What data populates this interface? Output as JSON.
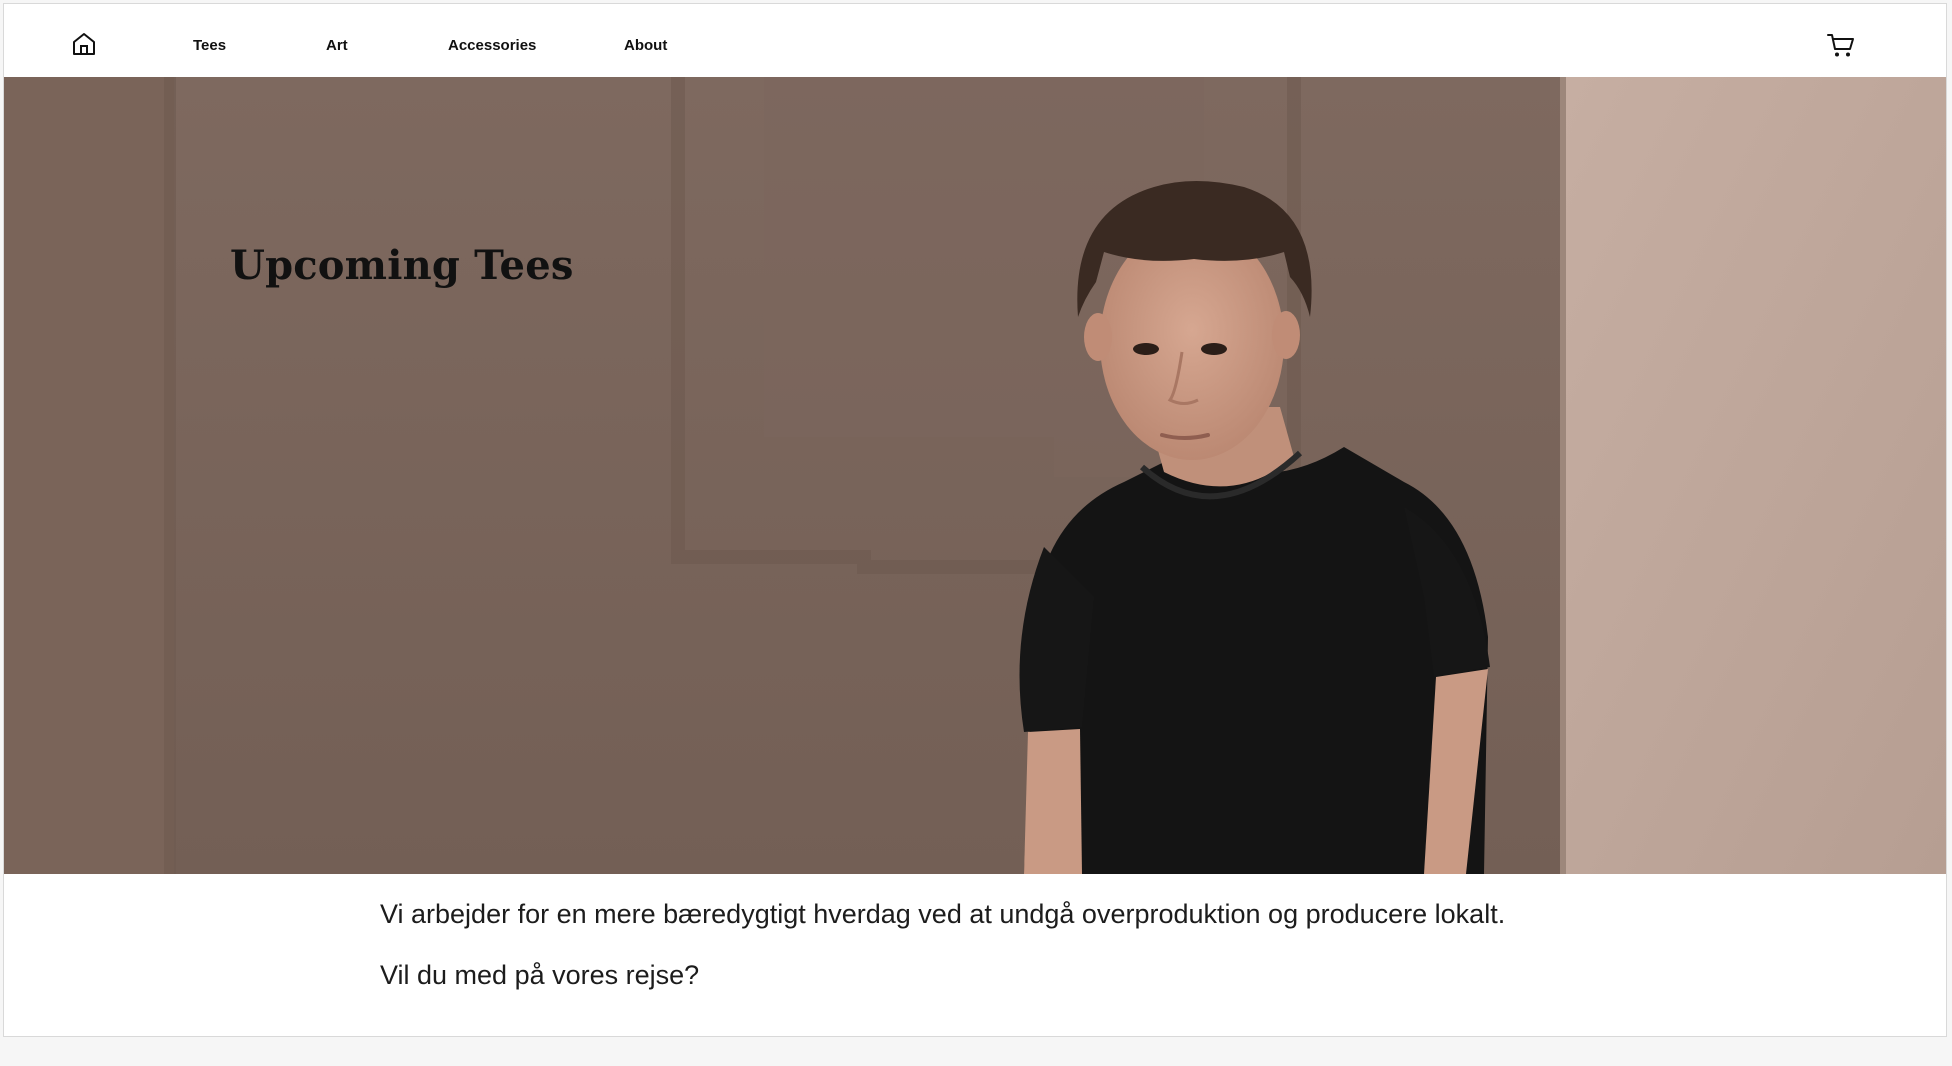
{
  "nav": {
    "home_icon": "home-icon",
    "links": [
      {
        "label": "Tees"
      },
      {
        "label": "Art"
      },
      {
        "label": "Accessories"
      },
      {
        "label": "About"
      }
    ],
    "cart_icon": "cart-icon"
  },
  "hero": {
    "title": "Upcoming Tees",
    "image": "portrait-photo"
  },
  "content": {
    "line1": "Vi arbejder for en mere bæredygtigt hverdag ved at undgå overproduktion og producere lokalt.",
    "line2": "Vil du med på vores rejse?"
  },
  "colors": {
    "wall": "#806c62",
    "wall_light": "#c2aa9e",
    "shirt": "#141414",
    "text": "#111111"
  }
}
